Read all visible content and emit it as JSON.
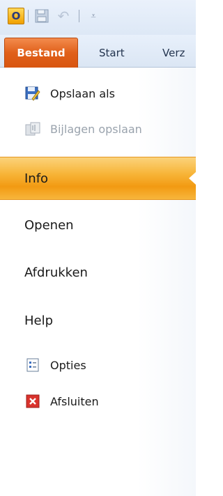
{
  "quick_access": {
    "app_icon_letter": "O",
    "app_icon_name": "outlook-icon",
    "items": [
      "save-icon",
      "undo-icon",
      "customize-toolbar-icon"
    ]
  },
  "tabs": {
    "file": "Bestand",
    "start": "Start",
    "next": "Verz"
  },
  "backstage": {
    "save_as": "Opslaan als",
    "save_attachments": "Bijlagen opslaan",
    "info": "Info",
    "open": "Openen",
    "print": "Afdrukken",
    "help": "Help",
    "options": "Opties",
    "exit": "Afsluiten"
  },
  "colors": {
    "file_tab": "#e0601a",
    "selected_item": "#f7b437",
    "ribbon_bg": "#dbe6f4"
  }
}
